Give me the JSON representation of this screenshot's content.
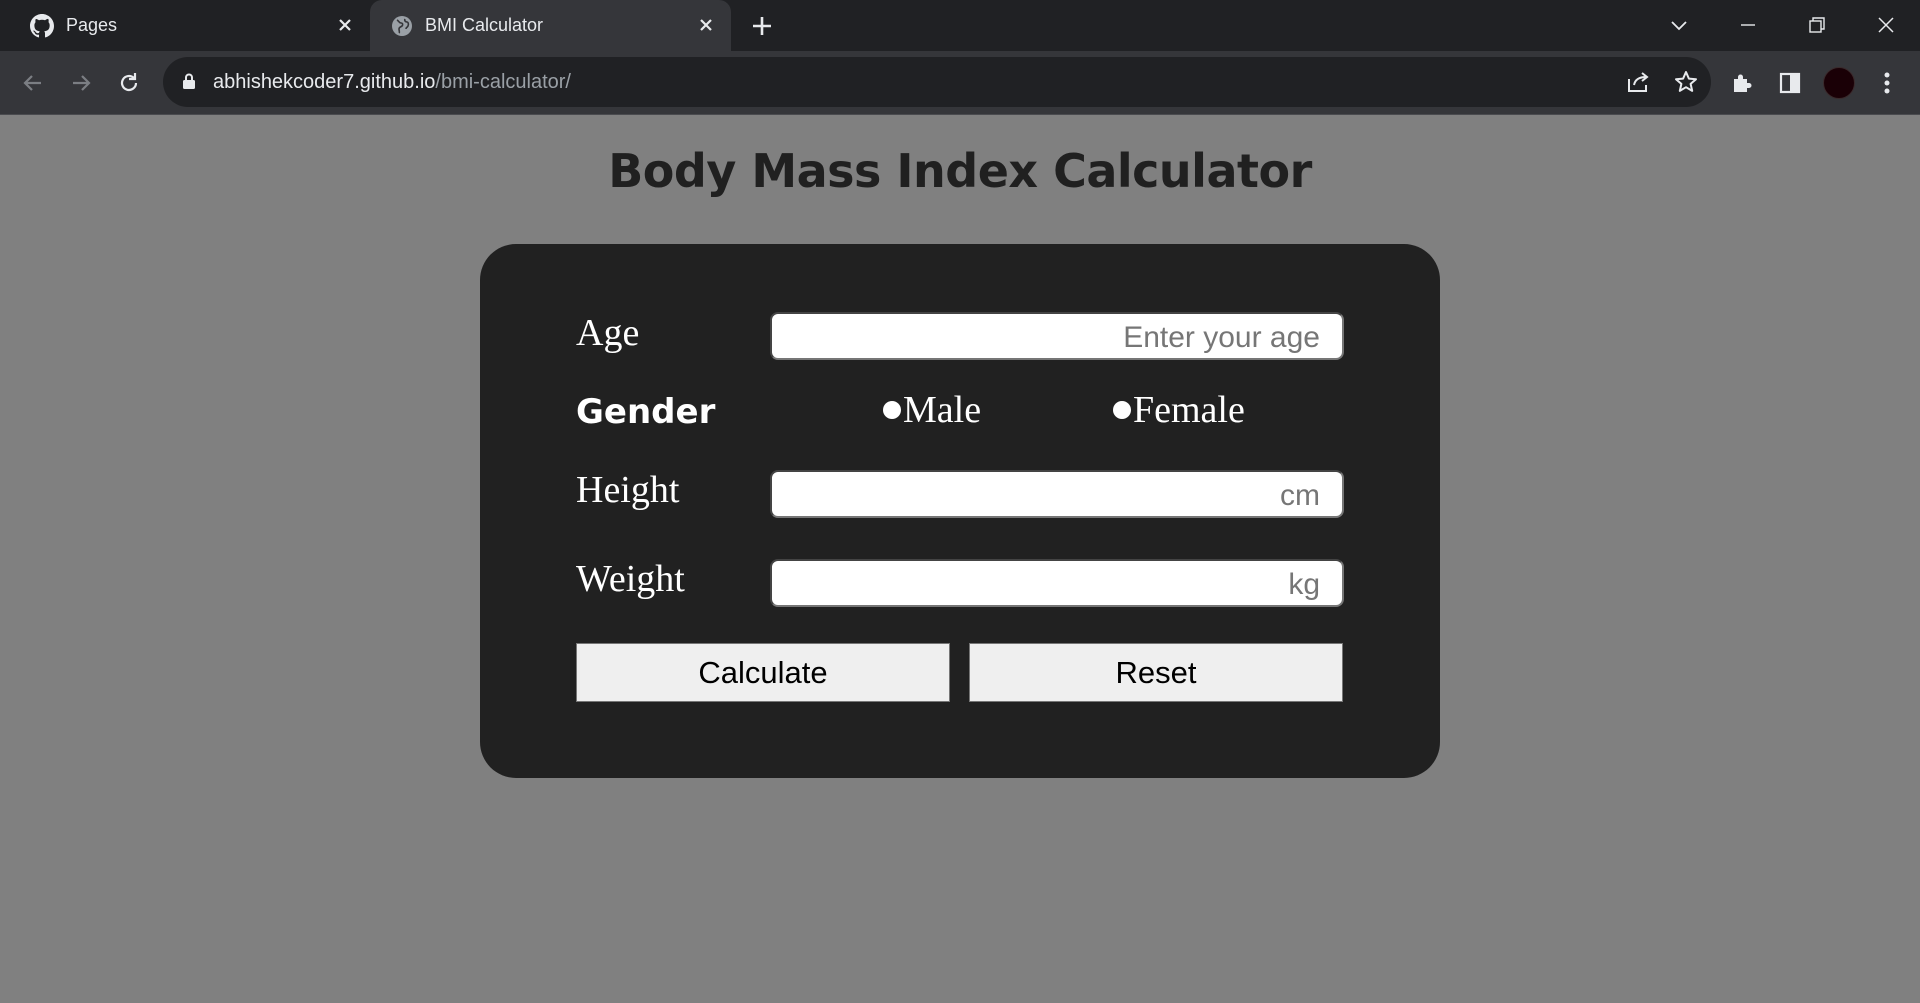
{
  "browser": {
    "tabs": [
      {
        "title": "Pages",
        "icon": "github-icon",
        "active": false
      },
      {
        "title": "BMI Calculator",
        "icon": "globe-icon",
        "active": true
      }
    ],
    "url_host": "abhishekcoder7.github.io",
    "url_path": "/bmi-calculator/"
  },
  "page": {
    "title": "Body Mass Index Calculator"
  },
  "form": {
    "age_label": "Age",
    "age_placeholder": "Enter your age",
    "gender_label": "Gender",
    "gender_options": [
      "Male",
      "Female"
    ],
    "height_label": "Height",
    "height_placeholder": "cm",
    "weight_label": "Weight",
    "weight_placeholder": "kg",
    "calculate_label": "Calculate",
    "reset_label": "Reset"
  },
  "colors": {
    "page_bg": "#808080",
    "card_bg": "#212121",
    "button_bg": "#efefef"
  }
}
